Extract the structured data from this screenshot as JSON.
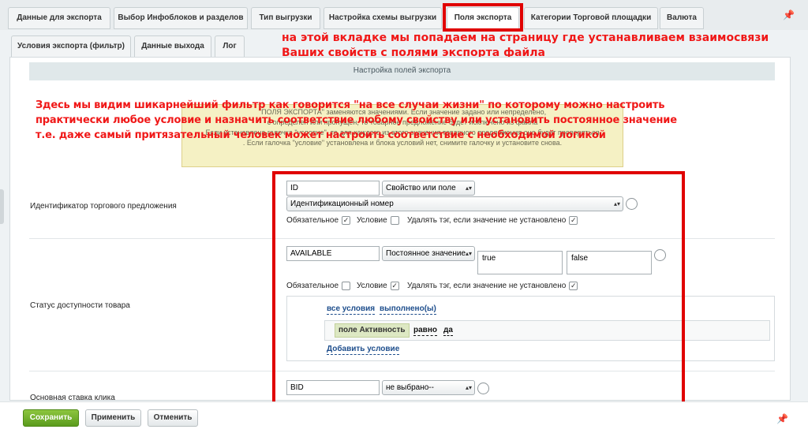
{
  "tabs_row1": [
    {
      "label": "Данные для экспорта"
    },
    {
      "label": "Выбор Инфоблоков и разделов"
    },
    {
      "label": "Тип выгрузки"
    },
    {
      "label": "Настройка схемы выгрузки"
    },
    {
      "label": "Поля экспорта"
    },
    {
      "label": "Категории Торговой площадки"
    },
    {
      "label": "Валюта"
    }
  ],
  "tabs_row2": [
    {
      "label": "Условия экспорта (фильтр)"
    },
    {
      "label": "Данные выхода"
    },
    {
      "label": "Лог"
    }
  ],
  "annotation_tab": {
    "line1": "на этой вкладке мы попадаем на страницу где устанавливаем взаимосвязи",
    "line2": "Ваших свойств с полями экспорта файла"
  },
  "section_title": "Настройка полей экспорта",
  "notice": {
    "line1": "\"ПОЛЯ ЭКСПОРТА\" заменяются значениями. Если значение задано или непределено,",
    "line2": "с определен или пропущен, то товарное предложение будет исключено из файла",
    "line3": "Если установлена галочка \"условие\", то для каждого из этого значения товарного предложения оно будет проверяться",
    "line4": ". Если галочка \"условие\" установлена и блока условий нет, снимите галочку и установите снова."
  },
  "annotation_filter": {
    "line1": "Здесь мы видим шикарнейший фильтр как говорится \"на все случаи жизни\"  по которому можно настроить",
    "line2": "практически любое условие и назначить соответствие любому свойству или установить постоянное значение",
    "line3": "т.е. даже самый притязательный человек может настроить соответствие с необходимой логикой"
  },
  "rows": {
    "offer_id": {
      "label": "Идентификатор торгового предложения",
      "field": "ID",
      "type": "Свойство или поле",
      "property": "Идентификационный номер",
      "required_label": "Обязательное",
      "required": "✓",
      "condition_label": "Условие",
      "condition": "",
      "delete_label": "Удалять тэг, если значение не установлено",
      "delete": "✓"
    },
    "availability": {
      "label": "Статус доступности товара",
      "field": "AVAILABLE",
      "type": "Постоянное значение",
      "value_true": "true",
      "value_false": "false",
      "required_label": "Обязательное",
      "required": "",
      "condition_label": "Условие",
      "condition": "✓",
      "delete_label": "Удалять тэг, если значение не установлено",
      "delete": "✓",
      "cond_all": "все условия",
      "cond_done": "выполнено(ы)",
      "cond_field": "поле Активность",
      "cond_op": "равно",
      "cond_val": "да",
      "add_condition": "Добавить условие"
    },
    "bid": {
      "label": "Основная ставка клика",
      "field": "BID",
      "type": "не выбрано--"
    }
  },
  "footer": {
    "save": "Сохранить",
    "apply": "Применить",
    "cancel": "Отменить"
  },
  "icons": {
    "pin": "pin-icon",
    "select_arrow": "▴▾"
  },
  "colors": {
    "annotation": "#f01818",
    "highlight_box": "#e00000",
    "save_button": "#6aaa2a"
  }
}
